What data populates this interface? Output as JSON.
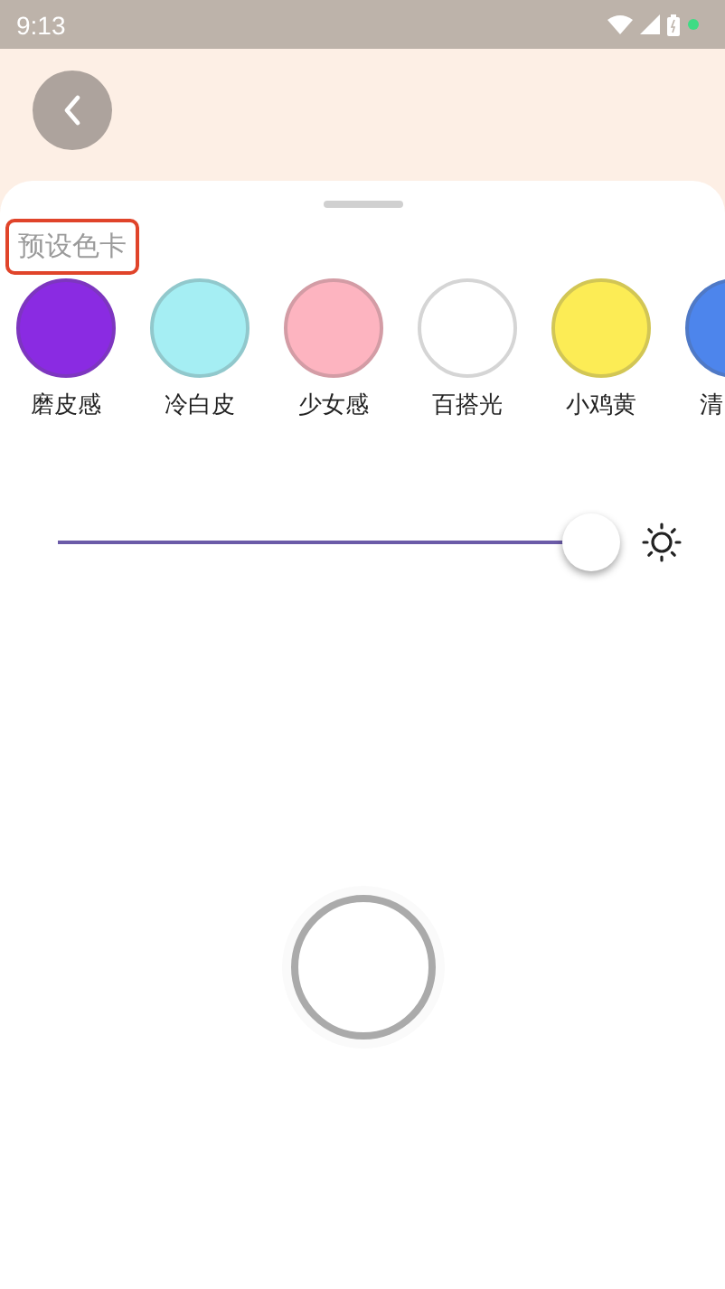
{
  "status_bar": {
    "time": "9:13"
  },
  "section_title": "预设色卡",
  "presets": [
    {
      "label": "磨皮感",
      "color": "#8a2be2"
    },
    {
      "label": "冷白皮",
      "color": "#a5eef3"
    },
    {
      "label": "少女感",
      "color": "#fdb4c0"
    },
    {
      "label": "百搭光",
      "color": "#ffffff"
    },
    {
      "label": "小鸡黄",
      "color": "#fcec55"
    },
    {
      "label": "清",
      "color": "#4d85ec"
    }
  ],
  "brightness": {
    "level": 1
  }
}
